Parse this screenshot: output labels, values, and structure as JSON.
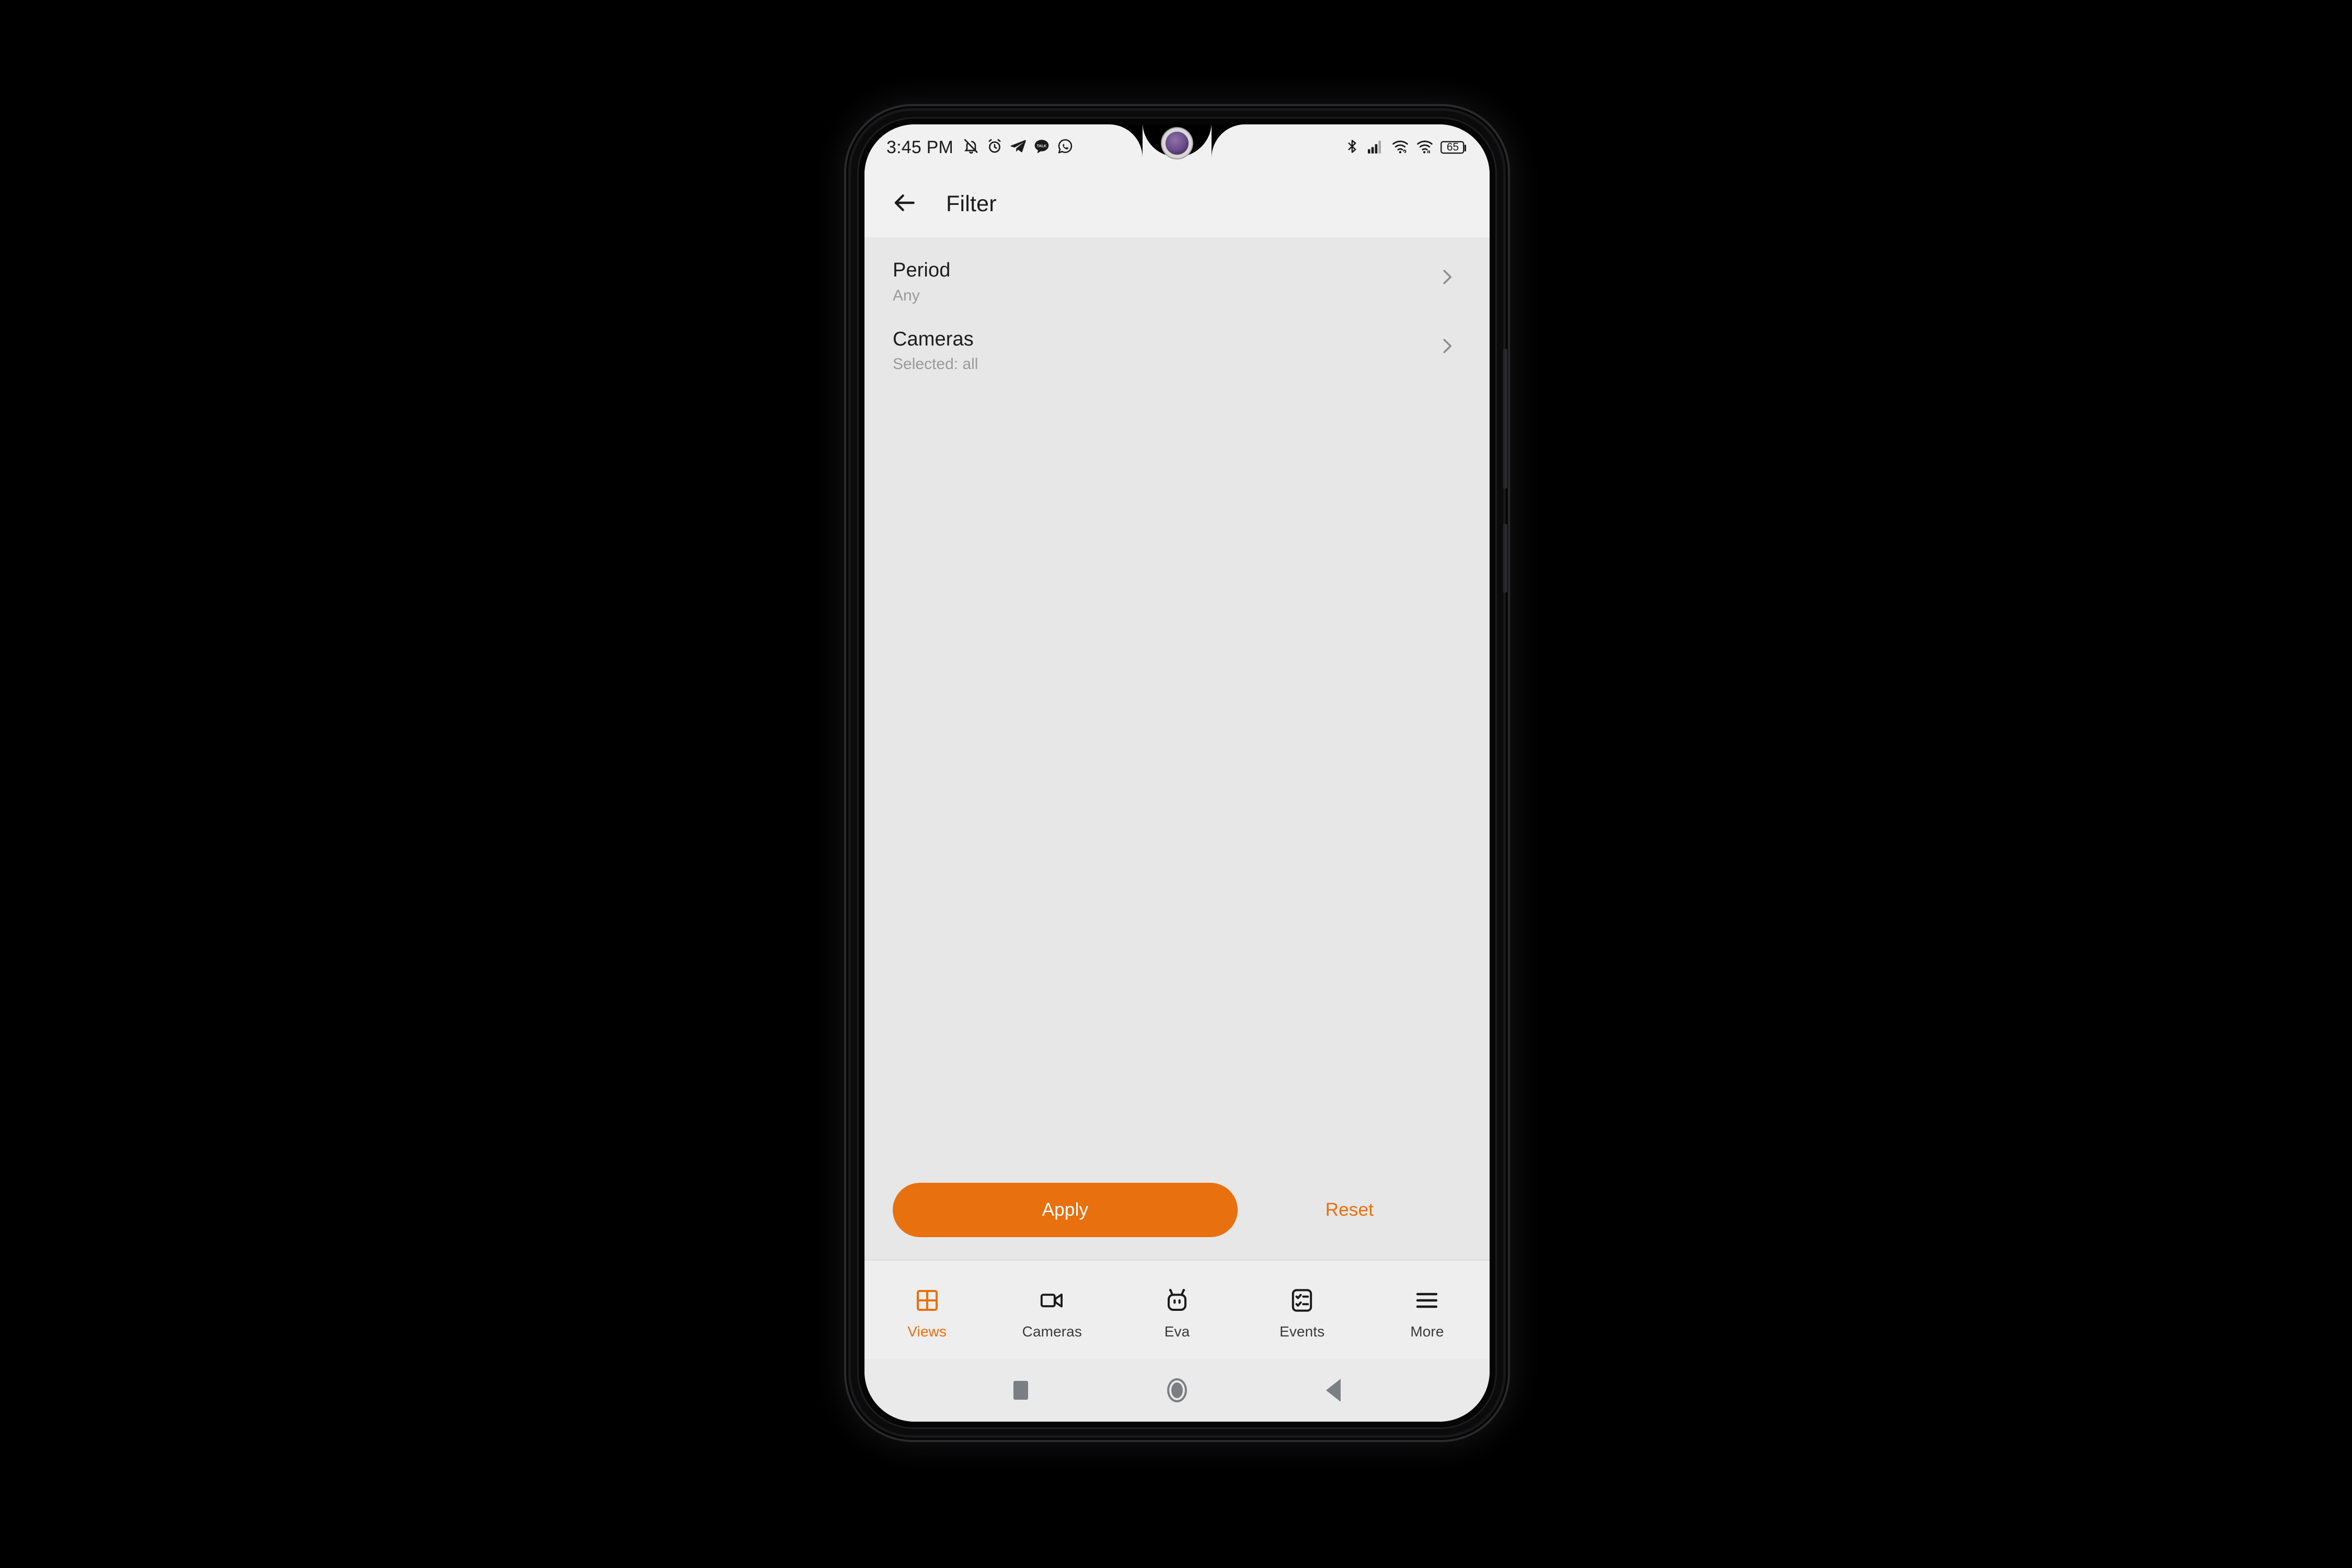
{
  "device": {
    "camera_icon": "front-camera-lens",
    "side_buttons": [
      "volume-rocker",
      "power-button"
    ]
  },
  "status_bar": {
    "time": "3:45 PM",
    "left_icons": [
      "mute-bell-icon",
      "alarm-clock-icon",
      "telegram-icon",
      "talk-message-icon",
      "whatsapp-icon"
    ],
    "right_icons": [
      "bluetooth-icon",
      "cellular-signal-icon",
      "wifi-icon",
      "wifi-secondary-icon"
    ],
    "battery_level": "65"
  },
  "app_bar": {
    "back_icon": "arrow-left-icon",
    "title": "Filter"
  },
  "filters": [
    {
      "title": "Period",
      "value": "Any",
      "chevron": "chevron-right-icon"
    },
    {
      "title": "Cameras",
      "value": "Selected: all",
      "chevron": "chevron-right-icon"
    }
  ],
  "actions": {
    "apply_label": "Apply",
    "reset_label": "Reset"
  },
  "tabs": [
    {
      "label": "Views",
      "icon": "grid-icon",
      "active": true
    },
    {
      "label": "Cameras",
      "icon": "video-camera-icon",
      "active": false
    },
    {
      "label": "Eva",
      "icon": "robot-icon",
      "active": false
    },
    {
      "label": "Events",
      "icon": "checklist-icon",
      "active": false
    },
    {
      "label": "More",
      "icon": "hamburger-menu-icon",
      "active": false
    }
  ],
  "system_nav": {
    "recents_icon": "square-recents-icon",
    "home_icon": "circle-home-icon",
    "back_icon": "triangle-back-icon"
  },
  "colors": {
    "accent": "#e8700f",
    "screen_bg": "#e7e7e7",
    "bar_bg": "#f1f1f1",
    "text_primary": "#1d1d1d",
    "text_secondary": "#9a9a9a",
    "device_frame": "#0b0b0c"
  }
}
